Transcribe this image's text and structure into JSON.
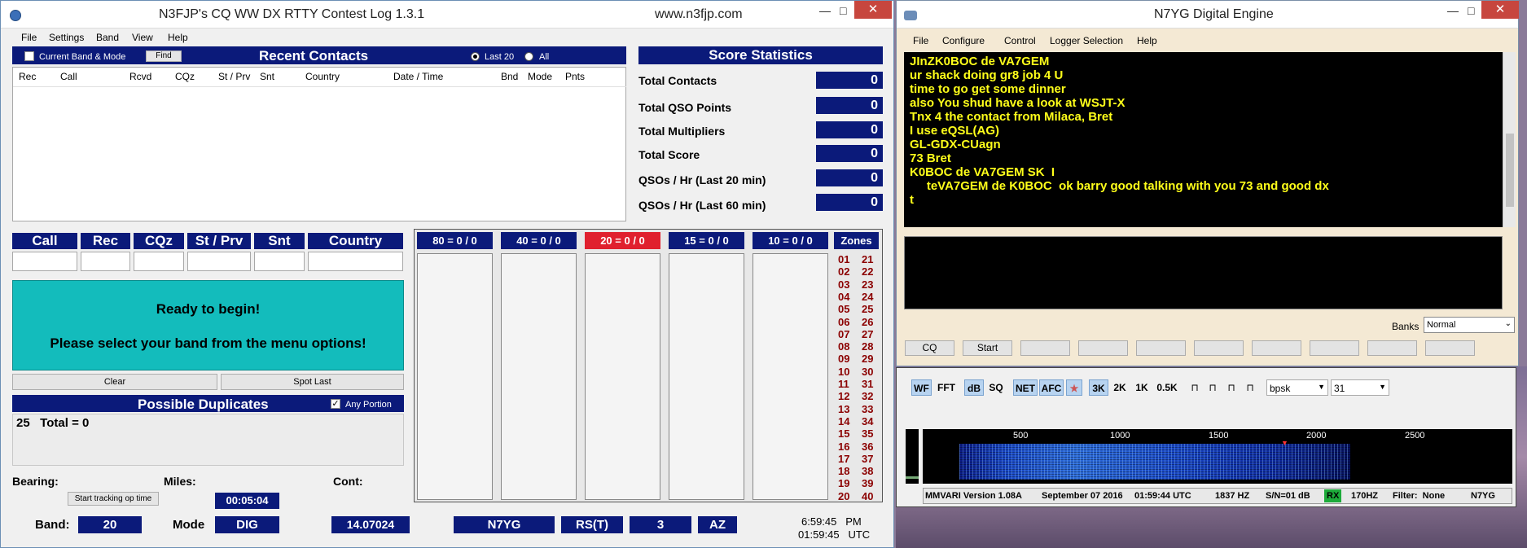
{
  "log_window": {
    "title": "N3FJP's CQ WW DX RTTY Contest Log 1.3.1",
    "url": "www.n3fjp.com",
    "menu": [
      "File",
      "Settings",
      "Band",
      "View",
      "Help"
    ],
    "current_band_mode_label": "Current Band & Mode",
    "find_label": "Find",
    "recent_contacts_title": "Recent Contacts",
    "last20_label": "Last 20",
    "all_label": "All",
    "columns": [
      "Rec",
      "Call",
      "Rcvd",
      "CQz",
      "St / Prv",
      "Snt",
      "Country",
      "Date  /  Time",
      "Bnd",
      "Mode",
      "Pnts"
    ],
    "score_title": "Score Statistics",
    "stats": [
      {
        "label": "Total Contacts",
        "value": "0"
      },
      {
        "label": "Total QSO Points",
        "value": "0"
      },
      {
        "label": "Total Multipliers",
        "value": "0"
      },
      {
        "label": "Total Score",
        "value": "0"
      },
      {
        "label": "QSOs / Hr (Last 20 min)",
        "value": "0"
      },
      {
        "label": "QSOs / Hr (Last 60 min)",
        "value": "0"
      }
    ],
    "fields": [
      "Call",
      "Rec",
      "CQz",
      "St / Prv",
      "Snt",
      "Country"
    ],
    "ready_line1": "Ready to begin!",
    "ready_line2": "Please select your band from the menu options!",
    "clear_label": "Clear",
    "spot_last_label": "Spot Last",
    "dup_title": "Possible Duplicates",
    "any_portion_label": "Any Portion",
    "dup_text": "25   Total = 0",
    "bearing_label": "Bearing:",
    "miles_label": "Miles:",
    "cont_label": "Cont:",
    "start_tracking_label": "Start tracking op time",
    "op_time": "00:05:04",
    "band_label": "Band:",
    "band_value": "20",
    "mode_label": "Mode",
    "mode_value": "DIG",
    "freq_value": "14.07024",
    "bottom_boxes": [
      "N7YG",
      "RS(T)",
      "3",
      "AZ"
    ],
    "local_time": "6:59:45   PM",
    "utc_time": "01:59:45   UTC",
    "bands": [
      {
        "label": "80 = 0 / 0",
        "color": "#0b1a7a"
      },
      {
        "label": "40 = 0 / 0",
        "color": "#0b1a7a"
      },
      {
        "label": "20 = 0 / 0",
        "color": "#e0202e"
      },
      {
        "label": "15 = 0 / 0",
        "color": "#0b1a7a"
      },
      {
        "label": "10 = 0 / 0",
        "color": "#0b1a7a"
      }
    ],
    "zones_title": "Zones",
    "zones_left": [
      "01",
      "02",
      "03",
      "04",
      "05",
      "06",
      "07",
      "08",
      "09",
      "10",
      "11",
      "12",
      "13",
      "14",
      "15",
      "16",
      "17",
      "18",
      "19",
      "20"
    ],
    "zones_right": [
      "21",
      "22",
      "23",
      "24",
      "25",
      "26",
      "27",
      "28",
      "29",
      "30",
      "31",
      "32",
      "33",
      "34",
      "35",
      "36",
      "37",
      "38",
      "39",
      "40"
    ]
  },
  "engine_window": {
    "title": "N7YG Digital Engine",
    "menu": [
      "File",
      "Configure",
      "Control",
      "Logger Selection",
      "Help"
    ],
    "rx_lines": [
      "JInZK0BOC de VA7GEM",
      "ur shack doing gr8 job 4 U",
      "time to go get some dinner",
      "also You shud have a look at WSJT-X",
      "Tnx 4 the contact from Milaca, Bret",
      "I use eQSL(AG)",
      "GL-GDX-CUagn",
      "73 Bret",
      "K0BOC de VA7GEM SK  I",
      "     teVA7GEM de K0BOC  ok barry good talking with you 73 and good dx",
      "t"
    ],
    "banks_label": "Banks",
    "banks_value": "Normal",
    "cq_label": "CQ",
    "start_label": "Start"
  },
  "mmvari": {
    "toolbar": [
      "WF",
      "FFT",
      "dB",
      "SQ",
      "NET",
      "AFC",
      "",
      "3K",
      "2K",
      "1K",
      "0.5K"
    ],
    "mode_value": "bpsk",
    "baud_value": "31",
    "freq_ticks": [
      "500",
      "1000",
      "1500",
      "2000",
      "2500"
    ],
    "status": {
      "version": "MMVARI Version 1.08A",
      "date": "September 07 2016",
      "time": "01:59:44 UTC",
      "freq": "1837 HZ",
      "sn": "S/N=01 dB",
      "rx": "RX",
      "bw": "170HZ",
      "filter": "Filter:  None",
      "call": "N7YG"
    }
  }
}
